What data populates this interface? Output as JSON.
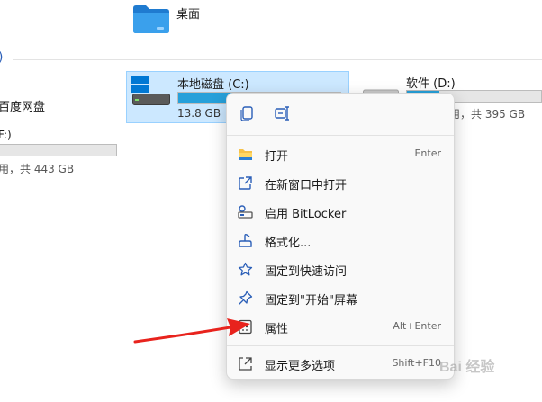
{
  "desktop_folder": {
    "label": "桌面",
    "icon": "folder-icon"
  },
  "section_header": {
    "glyph": ")"
  },
  "left_items": {
    "baidu_label": "百度网盘",
    "f_drive_name": "F:)",
    "f_drive_usage": "用，共 443 GB"
  },
  "drive_c": {
    "name": "本地磁盘 (C:)",
    "usage_text": "13.8 GB",
    "used_fraction": 0.93,
    "icon": "windows-logo-icon"
  },
  "drive_d": {
    "name": "软件 (D:)",
    "usage_text": "用，共 395 GB",
    "used_fraction": 0.24
  },
  "context_menu": {
    "top_actions": [
      {
        "name": "copy-icon"
      },
      {
        "name": "rename-icon"
      }
    ],
    "items": [
      {
        "label": "打开",
        "shortcut": "Enter",
        "icon": "folder-open-icon"
      },
      {
        "label": "在新窗口中打开",
        "shortcut": "",
        "icon": "open-new-window-icon"
      },
      {
        "label": "启用 BitLocker",
        "shortcut": "",
        "icon": "bitlocker-key-icon"
      },
      {
        "label": "格式化...",
        "shortcut": "",
        "icon": "format-icon"
      },
      {
        "label": "固定到快速访问",
        "shortcut": "",
        "icon": "star-icon"
      },
      {
        "label": "固定到\"开始\"屏幕",
        "shortcut": "",
        "icon": "pin-icon"
      },
      {
        "label": "属性",
        "shortcut": "Alt+Enter",
        "icon": "properties-icon"
      }
    ],
    "more_options": {
      "label": "显示更多选项",
      "shortcut": "Shift+F10",
      "icon": "more-options-icon"
    }
  },
  "colors": {
    "accent": "#0067c0",
    "selection_bg": "#cce8ff",
    "bar_fill": "#26a0da",
    "arrow": "#e8231d"
  },
  "watermark": {
    "text": "Bai 经验"
  }
}
